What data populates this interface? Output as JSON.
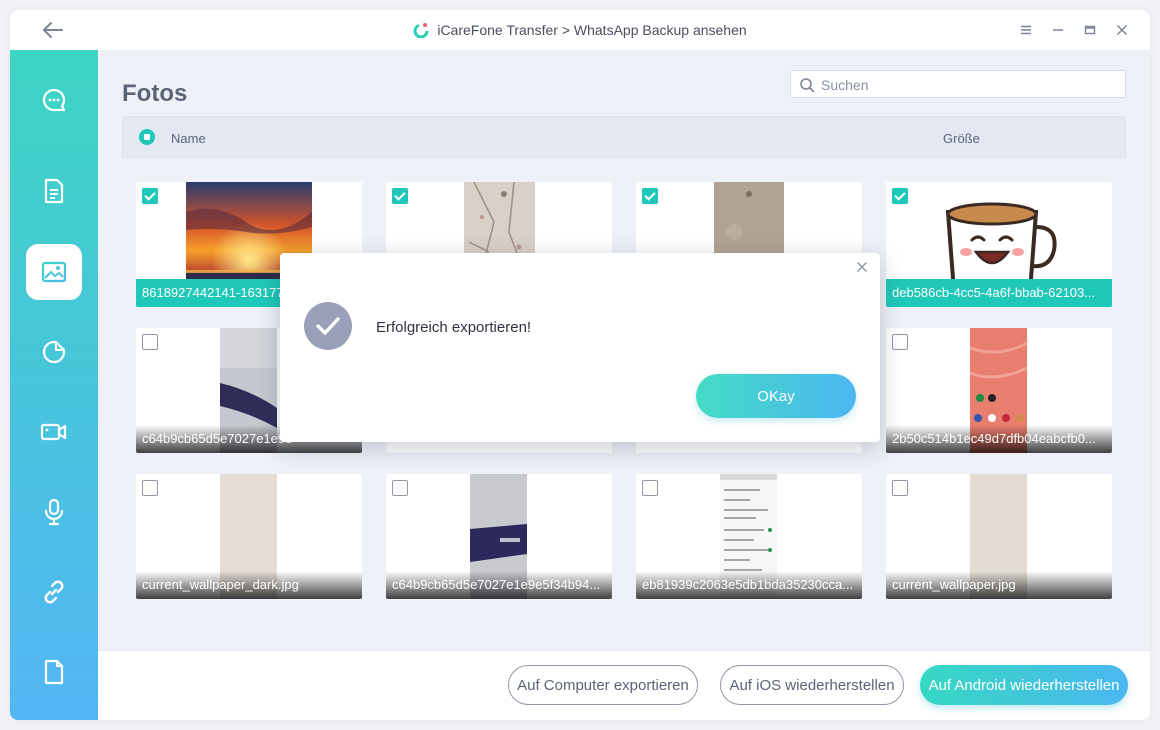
{
  "window": {
    "title": "iCareFone Transfer > WhatsApp Backup ansehen"
  },
  "sidebar": {
    "items": [
      {
        "icon": "chat-icon",
        "active": false
      },
      {
        "icon": "document-icon",
        "active": false
      },
      {
        "icon": "image-icon",
        "active": true
      },
      {
        "icon": "sticker-icon",
        "active": false
      },
      {
        "icon": "video-icon",
        "active": false
      },
      {
        "icon": "microphone-icon",
        "active": false
      },
      {
        "icon": "link-icon",
        "active": false
      },
      {
        "icon": "file-icon",
        "active": false
      }
    ]
  },
  "main": {
    "title": "Fotos",
    "search_placeholder": "Suchen",
    "header": {
      "name": "Name",
      "size": "Größe"
    }
  },
  "photos": [
    {
      "caption": "8618927442141-16317760",
      "checked": true
    },
    {
      "caption": "",
      "checked": true
    },
    {
      "caption": "",
      "checked": true
    },
    {
      "caption": "deb586cb-4cc5-4a6f-bbab-62103...",
      "checked": true
    },
    {
      "caption": "c64b9cb65d5e7027e1e9e",
      "checked": false
    },
    {
      "caption": "",
      "checked": false
    },
    {
      "caption": "",
      "checked": false
    },
    {
      "caption": "2b50c514b1ec49d7dfb04eabcfb0...",
      "checked": false
    },
    {
      "caption": "current_wallpaper_dark.jpg",
      "checked": false
    },
    {
      "caption": "c64b9cb65d5e7027e1e9e5f34b94...",
      "checked": false
    },
    {
      "caption": "eb81939c2063e5db1bda35230cca...",
      "checked": false
    },
    {
      "caption": "current_wallpaper.jpg",
      "checked": false
    }
  ],
  "footer": {
    "export_computer": "Auf Computer exportieren",
    "restore_ios": "Auf iOS wiederherstellen",
    "restore_android": "Auf Android wiederherstellen"
  },
  "dialog": {
    "message": "Erfolgreich exportieren!",
    "ok_label": "OKay"
  },
  "colors": {
    "accent": "#1fc8b8",
    "sidebar_top": "#3dd5c3",
    "sidebar_bottom": "#53b6f3",
    "text_muted": "#5b6477",
    "success_icon": "#9aa0b8"
  }
}
